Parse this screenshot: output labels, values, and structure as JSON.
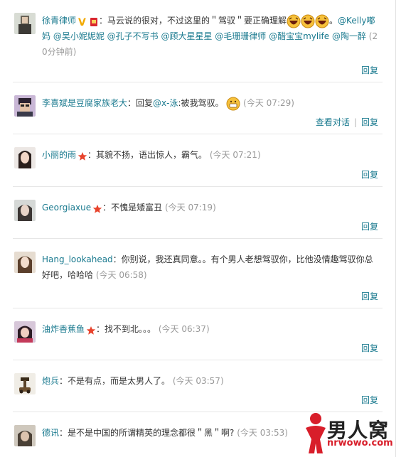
{
  "comments": [
    {
      "user": "徐青律师",
      "text_before": "：马云说的很对，不过这里的＂驾驭＂要正确理解",
      "text_after": "。",
      "mentions": "@Kelly嘟妈 @吴小妮妮妮 @孔子不写书 @顾大星星星 @毛珊珊律师 @醋宝宝mylife @陶一醉",
      "time": "(20分钟前)",
      "actions": [
        "回复"
      ]
    },
    {
      "user": "李喜斌是豆腐家族老大",
      "text_before": "：回复",
      "reply_mention": "@x-泳",
      "text_after": ":被我驾驭。",
      "time": "(今天 07:29)",
      "actions": [
        "查看对话",
        "回复"
      ]
    },
    {
      "user": "小丽的雨",
      "text_before": "：其貌不扬，语出惊人，霸气。",
      "time": "(今天 07:21)",
      "actions": [
        "回复"
      ]
    },
    {
      "user": "Georgiaxue",
      "text_before": "：不愧是矮富丑",
      "time": "(今天 07:19)",
      "actions": [
        "回复"
      ]
    },
    {
      "user": "Hang_lookahead",
      "text_before": "：你别说，我还真同意。。有个男人老想驾驭你，比他没情趣驾驭你总好吧，哈哈哈",
      "time": "(今天 06:58)",
      "actions": [
        "回复"
      ]
    },
    {
      "user": "油炸香蕉鱼",
      "text_before": "：找不到北。。。",
      "time": "(今天 06:37)",
      "actions": [
        "回复"
      ]
    },
    {
      "user": "炮兵",
      "text_before": "：不是有点，而是太男人了。",
      "time": "(今天 03:57)",
      "actions": [
        "回复"
      ]
    },
    {
      "user": "德讯",
      "text_before": "：是不是中国的所谓精英的理念都很＂黑＂啊?",
      "time": "(今天 03:53)",
      "actions": []
    }
  ],
  "watermark": {
    "title": "男人窝",
    "url": "nrwowo.com"
  },
  "colors": {
    "link": "#1a7a8f",
    "time": "#999999",
    "divider": "#e6e6e6",
    "star": "#e8432c"
  }
}
